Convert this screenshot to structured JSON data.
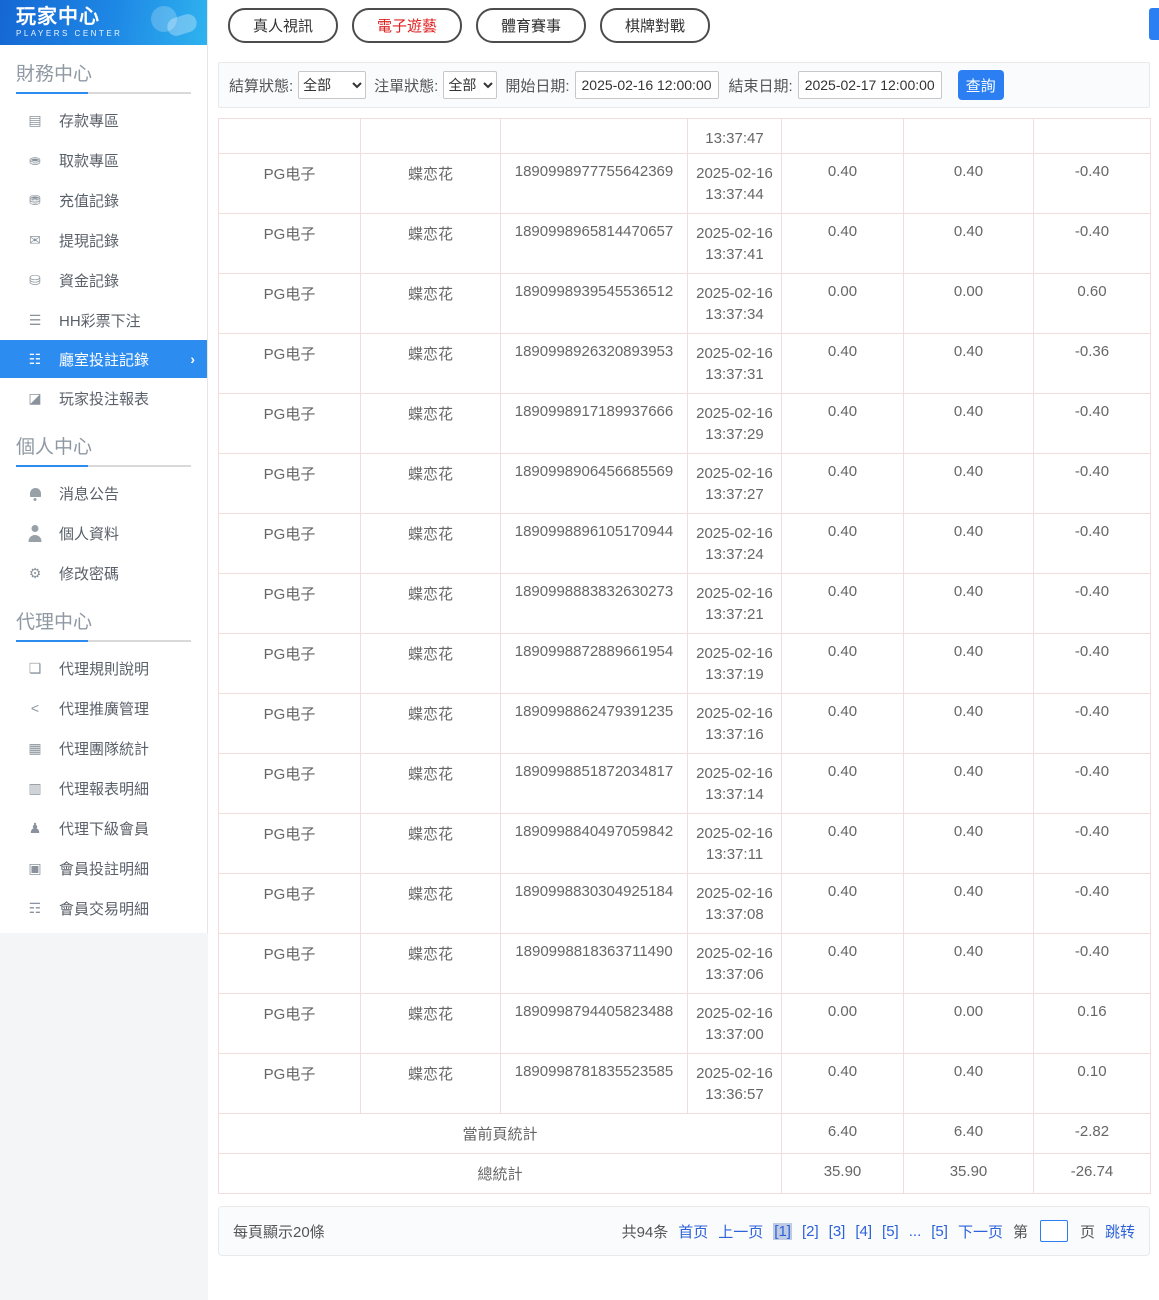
{
  "app": {
    "title": "玩家中心",
    "subtitle": "PLAYERS CENTER"
  },
  "colors": {
    "accent_blue": "#2d8cf0",
    "button_blue": "#2b7ff2",
    "link_blue": "#2c62d9",
    "active_tab_red": "#e02020",
    "table_border_pink": "#f3dcdc"
  },
  "sidebar": {
    "sections": [
      {
        "title": "財務中心",
        "items": [
          {
            "label": "存款專區",
            "icon": "deposit-card-icon",
            "glyph": "▤"
          },
          {
            "label": "取款專區",
            "icon": "withdraw-icon",
            "glyph": "⛂"
          },
          {
            "label": "充值記錄",
            "icon": "recharge-record-icon",
            "glyph": "⛃"
          },
          {
            "label": "提現記錄",
            "icon": "withdrawal-record-icon",
            "glyph": "✉"
          },
          {
            "label": "資金記錄",
            "icon": "funds-record-icon",
            "glyph": "⛁"
          },
          {
            "label": "HH彩票下注",
            "icon": "lottery-bet-icon",
            "glyph": "☰"
          },
          {
            "label": "廳室投註記錄",
            "icon": "room-bet-record-icon",
            "glyph": "☷",
            "active": true,
            "arrow": "›"
          },
          {
            "label": "玩家投注報表",
            "icon": "player-report-icon",
            "glyph": "◪"
          }
        ]
      },
      {
        "title": "個人中心",
        "items": [
          {
            "label": "消息公告",
            "icon": "bell-icon",
            "glyph": ""
          },
          {
            "label": "個人資料",
            "icon": "user-icon",
            "glyph": ""
          },
          {
            "label": "修改密碼",
            "icon": "gear-icon",
            "glyph": "⚙"
          }
        ]
      },
      {
        "title": "代理中心",
        "items": [
          {
            "label": "代理規則說明",
            "icon": "document-icon",
            "glyph": "❏"
          },
          {
            "label": "代理推廣管理",
            "icon": "share-icon",
            "glyph": "<"
          },
          {
            "label": "代理團隊統計",
            "icon": "team-stats-icon",
            "glyph": "▦"
          },
          {
            "label": "代理報表明細",
            "icon": "report-detail-icon",
            "glyph": "▥"
          },
          {
            "label": "代理下級會員",
            "icon": "members-icon",
            "glyph": "♟"
          },
          {
            "label": "會員投註明細",
            "icon": "member-bet-detail-icon",
            "glyph": "▣"
          },
          {
            "label": "會員交易明細",
            "icon": "member-transaction-icon",
            "glyph": "☶"
          }
        ]
      }
    ]
  },
  "tabs": [
    {
      "label": "真人視訊"
    },
    {
      "label": "電子遊藝",
      "active": true
    },
    {
      "label": "體育賽事"
    },
    {
      "label": "棋牌對戰"
    }
  ],
  "filters": {
    "settle_status_label": "結算狀態:",
    "settle_status_value": "全部",
    "order_status_label": "注單狀態:",
    "order_status_value": "全部",
    "start_date_label": "開始日期:",
    "start_date_value": "2025-02-16 12:00:00",
    "end_date_label": "結束日期:",
    "end_date_value": "2025-02-17 12:00:00",
    "search_label": "查詢"
  },
  "table": {
    "partial_row_time": "13:37:47",
    "rows": [
      {
        "provider": "PG电子",
        "game": "蝶恋花",
        "order_no": "1890998977755642369",
        "date": "2025-02-16",
        "time": "13:37:44",
        "bet": "0.40",
        "valid_bet": "0.40",
        "win_loss": "-0.40"
      },
      {
        "provider": "PG电子",
        "game": "蝶恋花",
        "order_no": "1890998965814470657",
        "date": "2025-02-16",
        "time": "13:37:41",
        "bet": "0.40",
        "valid_bet": "0.40",
        "win_loss": "-0.40"
      },
      {
        "provider": "PG电子",
        "game": "蝶恋花",
        "order_no": "1890998939545536512",
        "date": "2025-02-16",
        "time": "13:37:34",
        "bet": "0.00",
        "valid_bet": "0.00",
        "win_loss": "0.60"
      },
      {
        "provider": "PG电子",
        "game": "蝶恋花",
        "order_no": "1890998926320893953",
        "date": "2025-02-16",
        "time": "13:37:31",
        "bet": "0.40",
        "valid_bet": "0.40",
        "win_loss": "-0.36"
      },
      {
        "provider": "PG电子",
        "game": "蝶恋花",
        "order_no": "1890998917189937666",
        "date": "2025-02-16",
        "time": "13:37:29",
        "bet": "0.40",
        "valid_bet": "0.40",
        "win_loss": "-0.40"
      },
      {
        "provider": "PG电子",
        "game": "蝶恋花",
        "order_no": "1890998906456685569",
        "date": "2025-02-16",
        "time": "13:37:27",
        "bet": "0.40",
        "valid_bet": "0.40",
        "win_loss": "-0.40"
      },
      {
        "provider": "PG电子",
        "game": "蝶恋花",
        "order_no": "1890998896105170944",
        "date": "2025-02-16",
        "time": "13:37:24",
        "bet": "0.40",
        "valid_bet": "0.40",
        "win_loss": "-0.40"
      },
      {
        "provider": "PG电子",
        "game": "蝶恋花",
        "order_no": "1890998883832630273",
        "date": "2025-02-16",
        "time": "13:37:21",
        "bet": "0.40",
        "valid_bet": "0.40",
        "win_loss": "-0.40"
      },
      {
        "provider": "PG电子",
        "game": "蝶恋花",
        "order_no": "1890998872889661954",
        "date": "2025-02-16",
        "time": "13:37:19",
        "bet": "0.40",
        "valid_bet": "0.40",
        "win_loss": "-0.40"
      },
      {
        "provider": "PG电子",
        "game": "蝶恋花",
        "order_no": "1890998862479391235",
        "date": "2025-02-16",
        "time": "13:37:16",
        "bet": "0.40",
        "valid_bet": "0.40",
        "win_loss": "-0.40"
      },
      {
        "provider": "PG电子",
        "game": "蝶恋花",
        "order_no": "1890998851872034817",
        "date": "2025-02-16",
        "time": "13:37:14",
        "bet": "0.40",
        "valid_bet": "0.40",
        "win_loss": "-0.40"
      },
      {
        "provider": "PG电子",
        "game": "蝶恋花",
        "order_no": "1890998840497059842",
        "date": "2025-02-16",
        "time": "13:37:11",
        "bet": "0.40",
        "valid_bet": "0.40",
        "win_loss": "-0.40"
      },
      {
        "provider": "PG电子",
        "game": "蝶恋花",
        "order_no": "1890998830304925184",
        "date": "2025-02-16",
        "time": "13:37:08",
        "bet": "0.40",
        "valid_bet": "0.40",
        "win_loss": "-0.40"
      },
      {
        "provider": "PG电子",
        "game": "蝶恋花",
        "order_no": "1890998818363711490",
        "date": "2025-02-16",
        "time": "13:37:06",
        "bet": "0.40",
        "valid_bet": "0.40",
        "win_loss": "-0.40"
      },
      {
        "provider": "PG电子",
        "game": "蝶恋花",
        "order_no": "1890998794405823488",
        "date": "2025-02-16",
        "time": "13:37:00",
        "bet": "0.00",
        "valid_bet": "0.00",
        "win_loss": "0.16"
      },
      {
        "provider": "PG电子",
        "game": "蝶恋花",
        "order_no": "1890998781835523585",
        "date": "2025-02-16",
        "time": "13:36:57",
        "bet": "0.40",
        "valid_bet": "0.40",
        "win_loss": "0.10"
      }
    ],
    "page_summary": {
      "label": "當前頁統計",
      "bet": "6.40",
      "valid_bet": "6.40",
      "win_loss": "-2.82"
    },
    "total_summary": {
      "label": "總統計",
      "bet": "35.90",
      "valid_bet": "35.90",
      "win_loss": "-26.74"
    }
  },
  "pagination": {
    "page_size_text": "每頁顯示20條",
    "total_text": "共94条",
    "first": "首页",
    "prev": "上一页",
    "pages": [
      {
        "label": "[1]",
        "current": true
      },
      {
        "label": "[2]"
      },
      {
        "label": "[3]"
      },
      {
        "label": "[4]"
      },
      {
        "label": "[5]"
      },
      {
        "label": "..."
      },
      {
        "label": "[5]"
      }
    ],
    "next": "下一页",
    "jump_prefix": "第",
    "jump_suffix": "页",
    "jump_label": "跳转"
  }
}
